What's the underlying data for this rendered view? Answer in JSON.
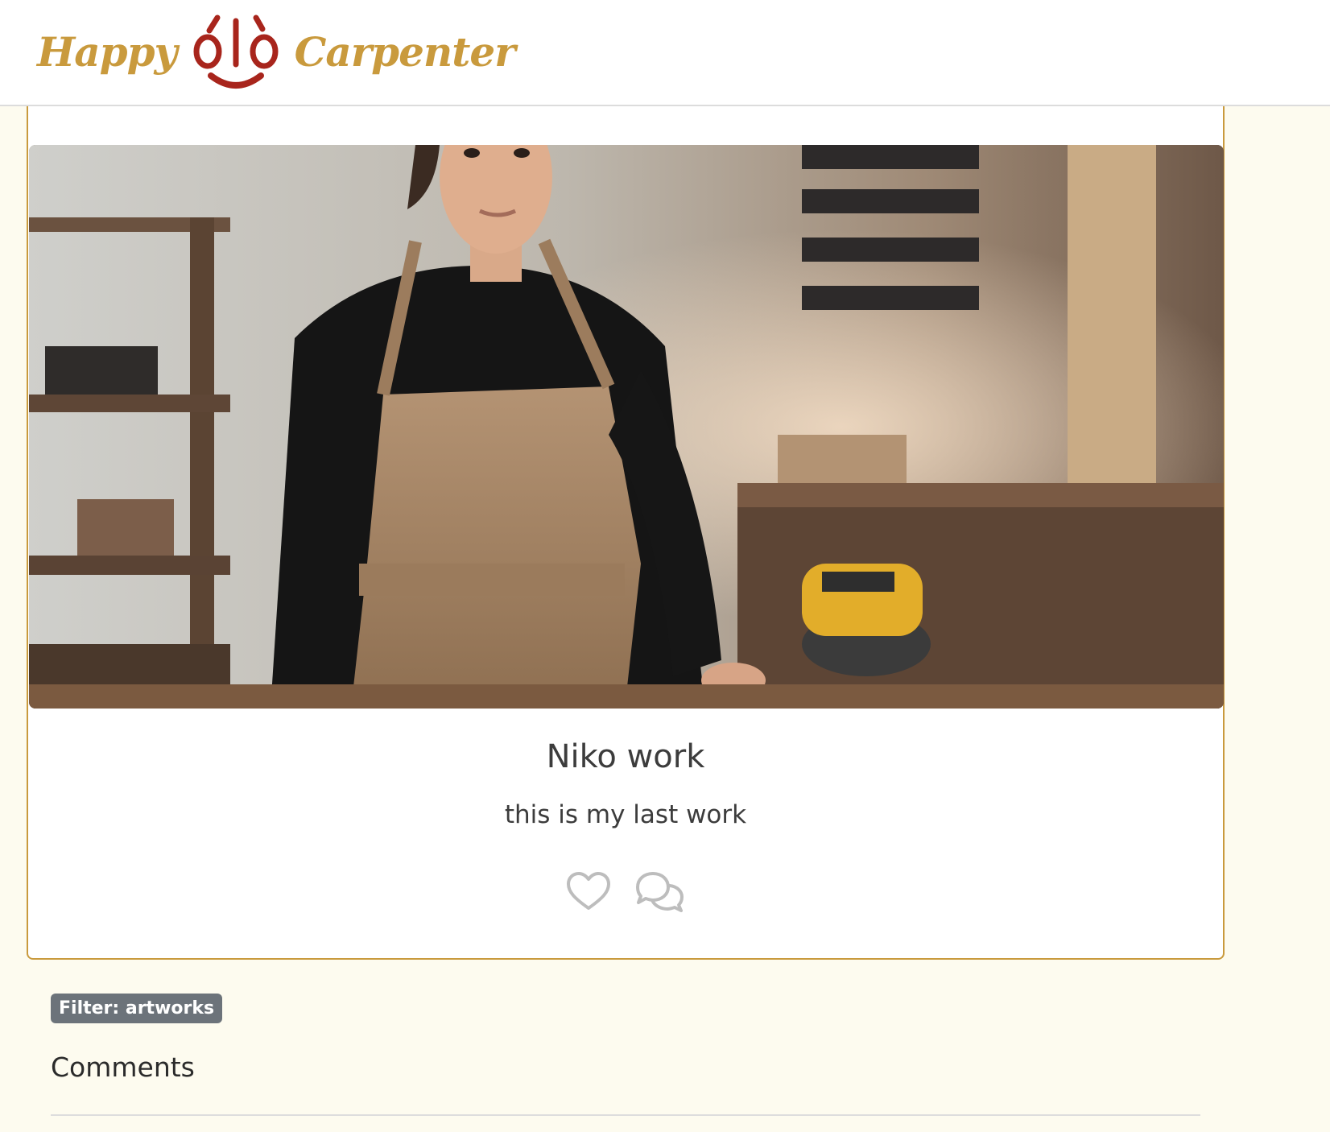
{
  "header": {
    "logo_left_word": "Happy",
    "logo_right_word": "Carpenter",
    "logo_mark_text": "ólò",
    "brand_color": "#c99a3d",
    "logo_mark_color": "#a8251c"
  },
  "post": {
    "title": "Niko work",
    "description": "this is my last work",
    "image_alt": "Woman in apron at a carpentry workshop with an orbital sander",
    "actions": {
      "like_icon": "heart-icon",
      "comment_icon": "comments-icon"
    }
  },
  "filter": {
    "label": "Filter: artworks"
  },
  "comments": {
    "heading": "Comments"
  },
  "colors": {
    "page_background": "#fdfbef",
    "card_border": "#c99a3d",
    "badge_background": "#6c737a",
    "text": "#3c3c3c"
  }
}
